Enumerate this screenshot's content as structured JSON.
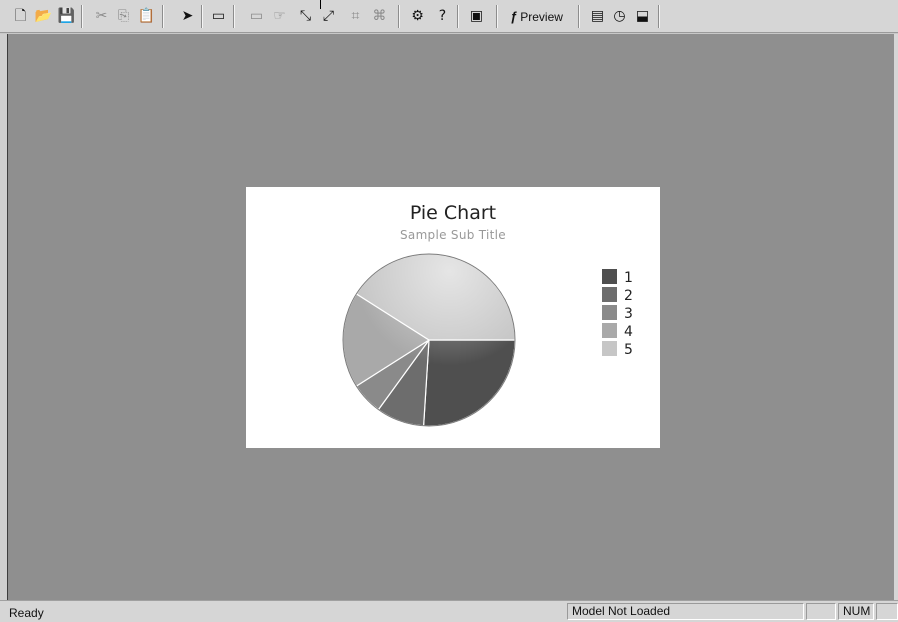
{
  "toolbar": {
    "buttons": [
      {
        "name": "new-icon",
        "glyph": "🗋"
      },
      {
        "name": "open-icon",
        "glyph": "📂"
      },
      {
        "name": "save-icon",
        "glyph": "💾"
      },
      {
        "name": "cut-icon",
        "glyph": "✂"
      },
      {
        "name": "copy-icon",
        "glyph": "⎘"
      },
      {
        "name": "paste-icon",
        "glyph": "📋"
      },
      {
        "name": "pointer-icon",
        "glyph": "➤"
      },
      {
        "name": "rectangle-icon",
        "glyph": "▭"
      },
      {
        "name": "line-icon",
        "glyph": "▭"
      },
      {
        "name": "hand-icon",
        "glyph": "☞"
      },
      {
        "name": "connector-icon",
        "glyph": "⤡"
      },
      {
        "name": "connector-alt-icon",
        "glyph": "⤢"
      },
      {
        "name": "align-icon",
        "glyph": "⌗"
      },
      {
        "name": "distribute-icon",
        "glyph": "⌘"
      },
      {
        "name": "plugin-icon",
        "glyph": "⚙"
      },
      {
        "name": "help-icon",
        "glyph": "?"
      },
      {
        "name": "image-icon",
        "glyph": "▣"
      },
      {
        "name": "preview-button"
      },
      {
        "name": "window-icon",
        "glyph": "▤"
      },
      {
        "name": "clock-icon",
        "glyph": "◷"
      },
      {
        "name": "export-icon",
        "glyph": "⬓"
      }
    ],
    "preview_fx": "ƒ",
    "preview_label": "Preview"
  },
  "chart_data": {
    "type": "pie",
    "title": "Pie Chart",
    "subtitle": "Sample Sub Title",
    "labels": [
      "1",
      "2",
      "3",
      "4",
      "5"
    ],
    "values": [
      26,
      9,
      6,
      18,
      41
    ],
    "colors": [
      "#4f4f4f",
      "#6d6d6d",
      "#8a8a8a",
      "#a9a9a9",
      "#c6c6c6"
    ],
    "legend_position": "right"
  },
  "statusbar": {
    "ready": "Ready",
    "model_status": "Model Not Loaded",
    "num": "NUM",
    "blank": ""
  }
}
